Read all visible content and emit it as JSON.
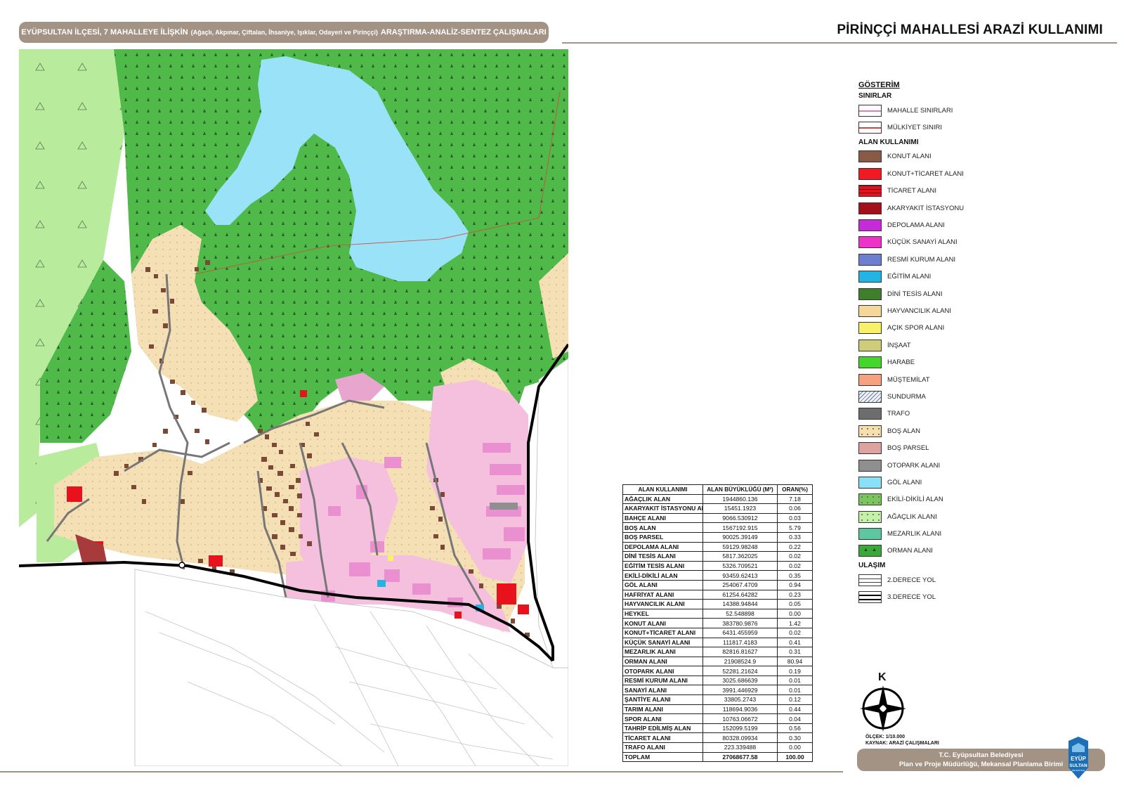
{
  "header": {
    "left_prefix": "EYÜPSULTAN İLÇESİ, 7 MAHALLEYE İLİŞKİN",
    "left_paren": "(Ağaçlı, Akpınar, Çiftalan, İhsaniye, Işıklar, Odayeri ve Pirinççi)",
    "left_suffix": "ARAŞTIRMA-ANALİZ-SENTEZ ÇALIŞMALARI",
    "title": "PİRİNÇÇİ MAHALLESİ ARAZİ KULLANIMI"
  },
  "colors": {
    "forest": "#4fb94a",
    "lake": "#99e2f7",
    "agricultural": "#b9eb9c",
    "vacant": "#f5dfb4",
    "official": "#f4c0de",
    "building": "#7a4a37",
    "commerce": "#e8121d",
    "road": "#000000",
    "brown_band": "#a39384"
  },
  "legend": {
    "title": "GÖSTERİM",
    "sections": [
      {
        "name": "SINIRLAR",
        "items": [
          {
            "label": "MAHALLE SINIRLARI",
            "fill": "#ffffff",
            "line": "#e87bb5",
            "pattern": "line"
          },
          {
            "label": "MÜLKİYET SINIRI",
            "fill": "#ffffff",
            "line": "#d9453b",
            "pattern": "line"
          }
        ]
      },
      {
        "name": "ALAN KULLANIMI",
        "items": [
          {
            "label": "KONUT ALANI",
            "fill": "#8a5a47",
            "pattern": "solid"
          },
          {
            "label": "KONUT+TİCARET ALANI",
            "fill": "#ef1a22",
            "pattern": "solid"
          },
          {
            "label": "TİCARET ALANI",
            "fill": "#e6131e",
            "pattern": "grid"
          },
          {
            "label": "AKARYAKIT İSTASYONU",
            "fill": "#a3101a",
            "pattern": "solid"
          },
          {
            "label": "DEPOLAMA ALANI",
            "fill": "#c52bd8",
            "pattern": "solid"
          },
          {
            "label": "KÜÇÜK SANAYİ ALANI",
            "fill": "#ee33c8",
            "pattern": "solid"
          },
          {
            "label": "RESMİ KURUM ALANI",
            "fill": "#6f7fd0",
            "pattern": "solid"
          },
          {
            "label": "EĞİTİM ALANI",
            "fill": "#23b4e4",
            "pattern": "solid"
          },
          {
            "label": "DİNİ TESİS ALANI",
            "fill": "#3f7f2c",
            "pattern": "solid"
          },
          {
            "label": "HAYVANCILIK ALANI",
            "fill": "#f5d79a",
            "pattern": "solid"
          },
          {
            "label": "AÇIK SPOR ALANI",
            "fill": "#f8f06a",
            "pattern": "solid"
          },
          {
            "label": "İNŞAAT",
            "fill": "#cfcd7a",
            "pattern": "solid"
          },
          {
            "label": "HARABE",
            "fill": "#44d62c",
            "pattern": "solid"
          },
          {
            "label": "MÜŞTEMİLAT",
            "fill": "#f6a180",
            "pattern": "solid"
          },
          {
            "label": "SUNDURMA",
            "fill": "#eef1f7",
            "pattern": "hatch"
          },
          {
            "label": "TRAFO",
            "fill": "#6d6d6d",
            "pattern": "solid"
          },
          {
            "label": "BOŞ ALAN",
            "fill": "#f6dfaf",
            "pattern": "dots"
          },
          {
            "label": "BOŞ PARSEL",
            "fill": "#dea3a0",
            "pattern": "solid"
          },
          {
            "label": "OTOPARK ALANI",
            "fill": "#8f8f8f",
            "pattern": "solid"
          },
          {
            "label": "GÖL ALANI",
            "fill": "#8ae0f7",
            "pattern": "solid"
          },
          {
            "label": "EKİLİ-DİKİLİ ALAN",
            "fill": "#79c65e",
            "pattern": "dots"
          },
          {
            "label": "AĞAÇLIK ALANI",
            "fill": "#c4f2a8",
            "pattern": "dots"
          },
          {
            "label": "MEZARLIK ALANI",
            "fill": "#5ec6a0",
            "pattern": "solid"
          },
          {
            "label": "ORMAN ALANI",
            "fill": "#3da83a",
            "pattern": "triangles"
          }
        ]
      },
      {
        "name": "ULAŞIM",
        "items": [
          {
            "label": "2.DERECE YOL",
            "fill": "#ffffff",
            "line": "#333333",
            "pattern": "road2"
          },
          {
            "label": "3.DERECE YOL",
            "fill": "#ffffff",
            "line": "#000000",
            "pattern": "road3"
          }
        ]
      }
    ]
  },
  "table": {
    "headers": [
      "ALAN KULLANIMI",
      "ALAN BÜYÜKLÜĞÜ (M²)",
      "ORAN(%)"
    ],
    "rows": [
      [
        "AĞAÇLIK ALAN",
        "1944860.136",
        "7.18"
      ],
      [
        "AKARYAKIT İSTASYONU AL",
        "15451.1923",
        "0.06"
      ],
      [
        "BAHÇE ALANI",
        "9066.530912",
        "0.03"
      ],
      [
        "BOŞ ALAN",
        "1567192.915",
        "5.79"
      ],
      [
        "BOŞ PARSEL",
        "90025.39149",
        "0.33"
      ],
      [
        "DEPOLAMA ALANI",
        "59129.98248",
        "0.22"
      ],
      [
        "DİNİ TESİS ALANI",
        "5817.362025",
        "0.02"
      ],
      [
        "EĞİTİM TESİS ALANI",
        "5326.709521",
        "0.02"
      ],
      [
        "EKİLİ-DİKİLİ ALAN",
        "93459.62413",
        "0.35"
      ],
      [
        "GÖL ALANI",
        "254067.4709",
        "0.94"
      ],
      [
        "HAFRİYAT ALANI",
        "61254.64282",
        "0.23"
      ],
      [
        "HAYVANCILIK ALANI",
        "14388.94844",
        "0.05"
      ],
      [
        "HEYKEL",
        "52.548898",
        "0.00"
      ],
      [
        "KONUT ALANI",
        "383780.9876",
        "1.42"
      ],
      [
        "KONUT+TİCARET ALANI",
        "6431.455959",
        "0.02"
      ],
      [
        "KÜÇÜK SANAYİ ALANI",
        "111817.4183",
        "0.41"
      ],
      [
        "MEZARLIK ALANI",
        "82816.81627",
        "0.31"
      ],
      [
        "ORMAN ALANI",
        "21908524.9",
        "80.94"
      ],
      [
        "OTOPARK ALANI",
        "52281.21624",
        "0.19"
      ],
      [
        "RESMİ KURUM ALANI",
        "3025.686639",
        "0.01"
      ],
      [
        "SANAYİ ALANI",
        "3991.446929",
        "0.01"
      ],
      [
        "ŞANTİYE ALANI",
        "33805.2743",
        "0.12"
      ],
      [
        "TARIM ALANI",
        "118694.9036",
        "0.44"
      ],
      [
        "SPOR ALANI",
        "10763.06672",
        "0.04"
      ],
      [
        "TAHRİP EDİLMİŞ ALAN",
        "152099.5199",
        "0.56"
      ],
      [
        "TİCARET ALANI",
        "80328.09934",
        "0.30"
      ],
      [
        "TRAFO ALANI",
        "223.339488",
        "0.00"
      ]
    ],
    "total": [
      "TOPLAM",
      "27068677.58",
      "100.00"
    ]
  },
  "compass": {
    "letter": "K",
    "icon": "north-arrow-icon"
  },
  "scale": {
    "line1": "ÖLÇEK: 1/10.000",
    "line2": "KAYNAK: ARAZİ ÇALIŞMALARI"
  },
  "footer": {
    "line1": "T.C. Eyüpsultan Belediyesi",
    "line2": "Plan ve Proje Müdürlüğü, Mekansal Planlama Birimi"
  },
  "logo": {
    "top": "EYÜP",
    "bottom": "SULTAN",
    "tiny": "BELEDİYESİ",
    "icon": "eyupsultan-logo-icon"
  }
}
